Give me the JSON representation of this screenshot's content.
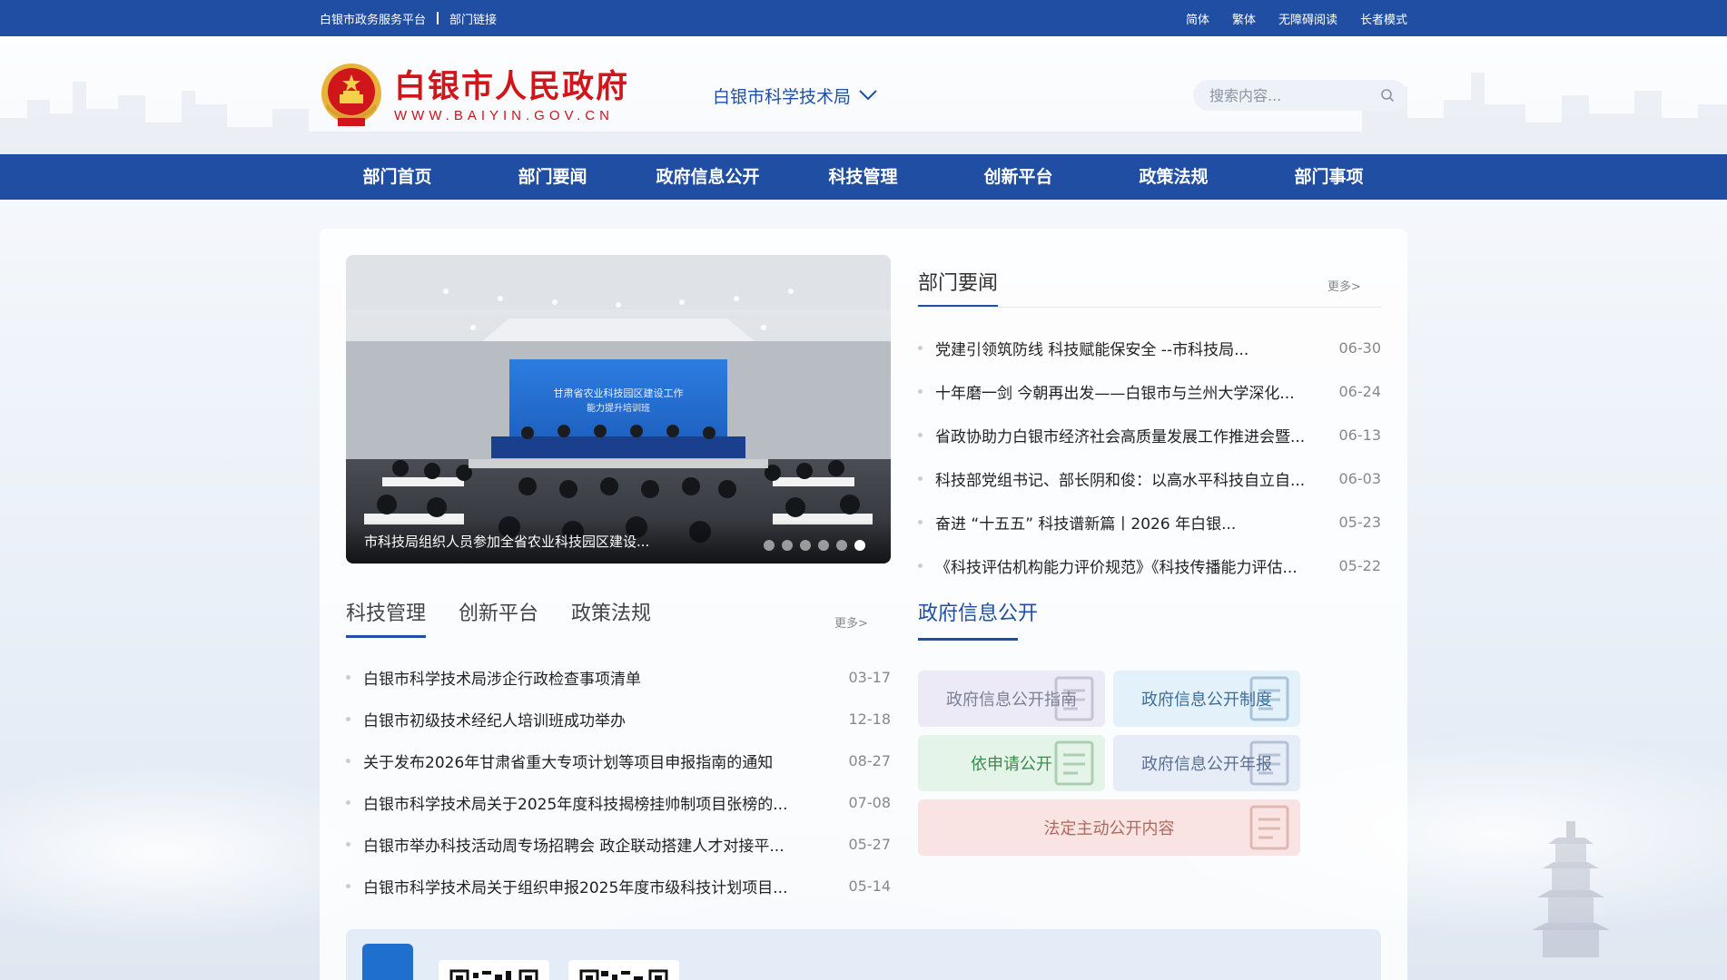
{
  "topbar": {
    "links_left": [
      "白银市政务服务平台",
      "部门链接"
    ],
    "links_right": [
      "简体",
      "繁体",
      "无障碍阅读",
      "长者模式"
    ]
  },
  "header": {
    "site_name": "白银市人民政府",
    "site_url": "WWW.BAIYIN.GOV.CN",
    "department": "白银市科学技术局",
    "search_placeholder": "搜索内容..."
  },
  "nav": {
    "items": [
      "部门首页",
      "部门要闻",
      "政府信息公开",
      "科技管理",
      "创新平台",
      "政策法规",
      "部门事项"
    ]
  },
  "carousel": {
    "caption": "市科技局组织人员参加全省农业科技园区建设...",
    "banner_text_line1": "甘肃省农业科技园区建设工作",
    "banner_text_line2": "能力提升培训班",
    "dots": 6,
    "active_dot": 6
  },
  "dept_news": {
    "title": "部门要闻",
    "more": "更多>",
    "items": [
      {
        "title": "党建引领筑防线 科技赋能保安全 --市科技局...",
        "date": "06-30"
      },
      {
        "title": "十年磨一剑 今朝再出发——白银市与兰州大学深化...",
        "date": "06-24"
      },
      {
        "title": "省政协助力白银市经济社会高质量发展工作推进会暨...",
        "date": "06-13"
      },
      {
        "title": "科技部党组书记、部长阴和俊：以高水平科技自立自...",
        "date": "06-03"
      },
      {
        "title": "奋进 “十五五” 科技谱新篇丨2026 年白银...",
        "date": "05-23"
      },
      {
        "title": "《科技评估机构能力评价规范》《科技传播能力评估...",
        "date": "05-22"
      }
    ]
  },
  "tabs": {
    "items": [
      "科技管理",
      "创新平台",
      "政策法规"
    ],
    "active": 0,
    "more": "更多>"
  },
  "tech_list": [
    {
      "title": "白银市科学技术局涉企行政检查事项清单",
      "date": "03-17"
    },
    {
      "title": "白银市初级技术经纪人培训班成功举办",
      "date": "12-18"
    },
    {
      "title": "关于发布2026年甘肃省重大专项计划等项目申报指南的通知",
      "date": "08-27"
    },
    {
      "title": "白银市科学技术局关于2025年度科技揭榜挂帅制项目张榜的...",
      "date": "07-08"
    },
    {
      "title": "白银市举办科技活动周专场招聘会 政企联动搭建人才对接平...",
      "date": "05-27"
    },
    {
      "title": "白银市科学技术局关于组织申报2025年度市级科技计划项目...",
      "date": "05-14"
    }
  ],
  "info_public": {
    "title": "政府信息公开",
    "cards": [
      {
        "label": "政府信息公开指南",
        "bg": "#eceaf7",
        "fg": "#7b7f95"
      },
      {
        "label": "政府信息公开制度",
        "bg": "#e3f1fb",
        "fg": "#3f6e9a"
      },
      {
        "label": "依申请公开",
        "bg": "#e5f4e8",
        "fg": "#3f8a4f"
      },
      {
        "label": "政府信息公开年报",
        "bg": "#e6edf7",
        "fg": "#5b6f93"
      },
      {
        "label": "法定主动公开内容",
        "bg": "#f9e3e3",
        "fg": "#b0695a"
      }
    ]
  },
  "colors": {
    "primary": "#1f4ea3",
    "brand_red": "#d0161b"
  }
}
